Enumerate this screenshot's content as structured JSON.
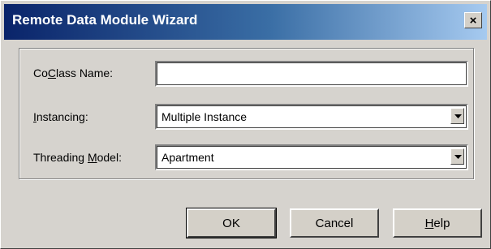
{
  "window": {
    "title": "Remote Data Module Wizard",
    "close_symbol": "×"
  },
  "form": {
    "coclass": {
      "label_prefix": "Co",
      "label_accel": "C",
      "label_suffix": "lass Name:",
      "value": ""
    },
    "instancing": {
      "label_prefix": "",
      "label_accel": "I",
      "label_suffix": "nstancing:",
      "value": "Multiple Instance"
    },
    "threading": {
      "label_prefix": "Threading ",
      "label_accel": "M",
      "label_suffix": "odel:",
      "value": "Apartment"
    }
  },
  "buttons": {
    "ok": "OK",
    "cancel": "Cancel",
    "help_accel": "H",
    "help_suffix": "elp"
  },
  "icons": {
    "close": "close-icon",
    "dropdown": "chevron-down-icon"
  }
}
